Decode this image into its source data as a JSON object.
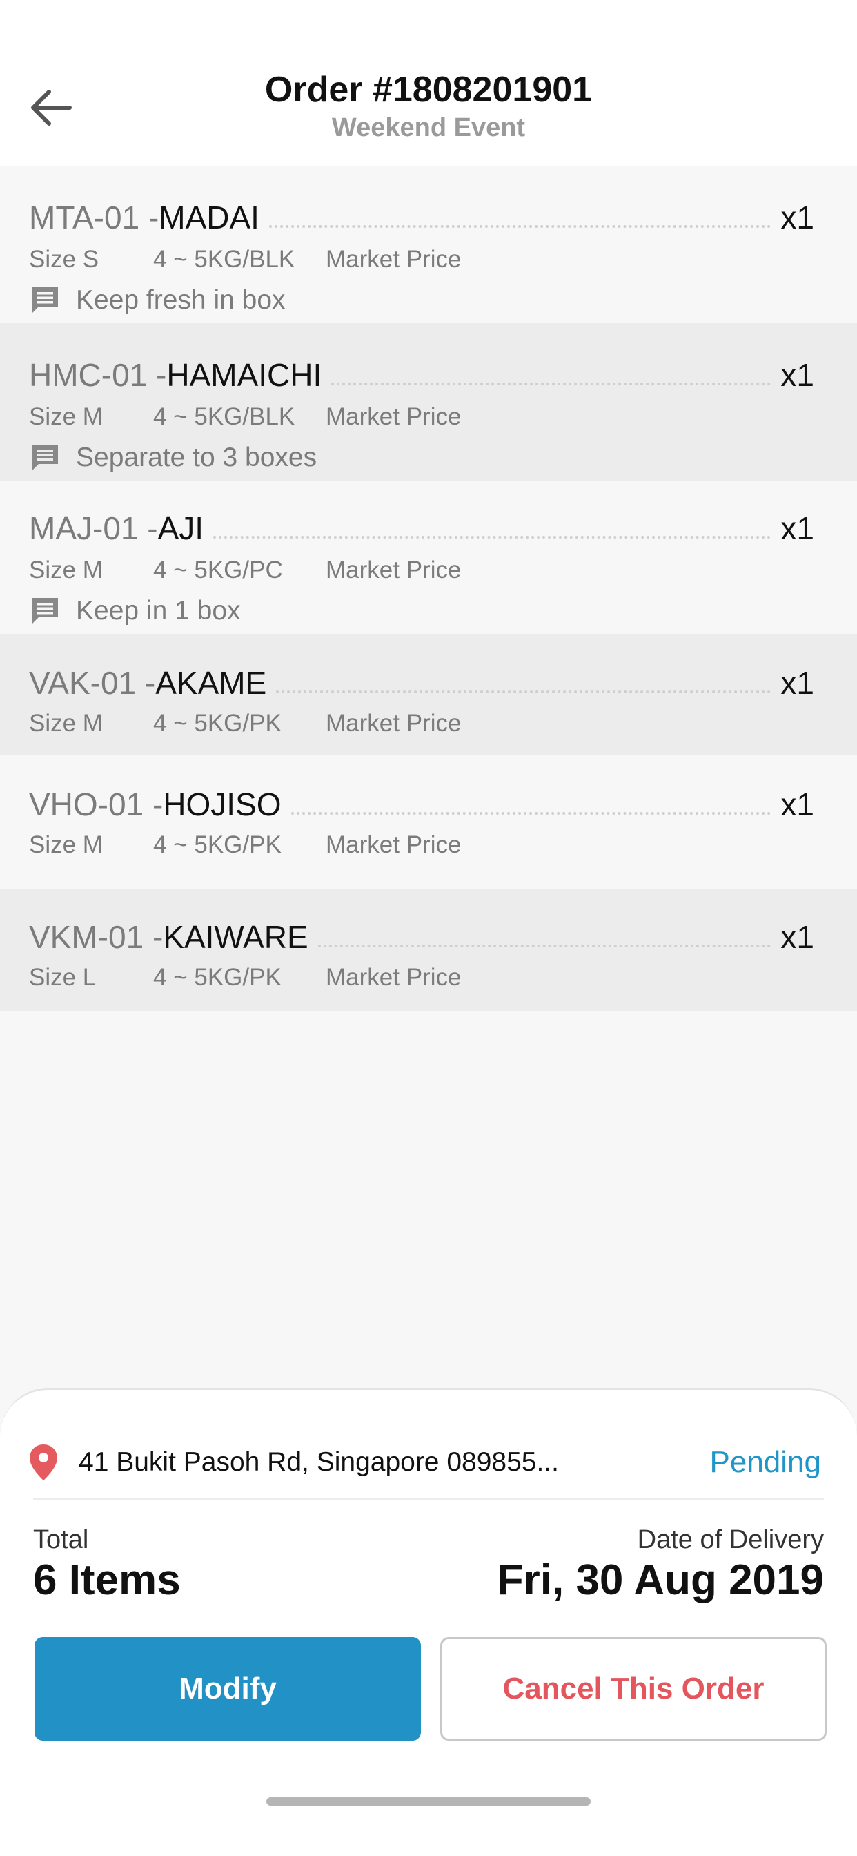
{
  "header": {
    "title": "Order #1808201901",
    "subtitle": "Weekend Event",
    "back_icon": "arrow-left-icon"
  },
  "items": [
    {
      "code": "MTA-01 - ",
      "name": "MADAI",
      "qty": "x1",
      "size": "Size S",
      "weight": "4 ~ 5KG/BLK",
      "price": "Market Price",
      "note": "Keep fresh in box"
    },
    {
      "code": "HMC-01 - ",
      "name": "HAMAICHI",
      "qty": "x1",
      "size": "Size M",
      "weight": "4 ~ 5KG/BLK",
      "price": "Market Price",
      "note": "Separate to 3 boxes"
    },
    {
      "code": "MAJ-01 - ",
      "name": "AJI",
      "qty": "x1",
      "size": "Size M",
      "weight": "4 ~ 5KG/PC",
      "price": "Market Price",
      "note": "Keep in 1 box"
    },
    {
      "code": "VAK-01 - ",
      "name": "AKAME",
      "qty": "x1",
      "size": "Size M",
      "weight": "4 ~ 5KG/PK",
      "price": "Market Price"
    },
    {
      "code": "VHO-01 - ",
      "name": "HOJISO",
      "qty": "x1",
      "size": "Size M",
      "weight": "4 ~ 5KG/PK",
      "price": "Market Price"
    },
    {
      "code": "VKM-01 - ",
      "name": "KAIWARE",
      "qty": "x1",
      "size": "Size L",
      "weight": "4 ~ 5KG/PK",
      "price": "Market Price"
    }
  ],
  "summary": {
    "address": "41 Bukit Pasoh Rd, Singapore 089855...",
    "status": "Pending",
    "total_label": "Total",
    "total_value": "6 Items",
    "date_label": "Date of Delivery",
    "date_value": "Fri, 30 Aug 2019"
  },
  "actions": {
    "modify_label": "Modify",
    "cancel_label": "Cancel This Order"
  },
  "colors": {
    "accent": "#2191c6",
    "status": "#1f95c9",
    "danger": "#e4565d",
    "pin": "#e55a5f"
  }
}
